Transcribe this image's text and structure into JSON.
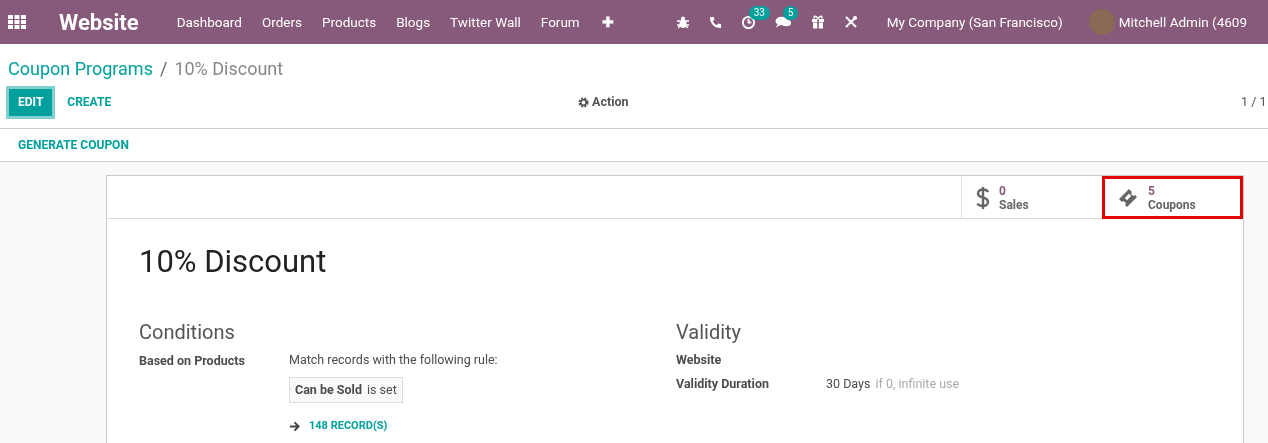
{
  "navbar": {
    "app_name": "Website",
    "menu": [
      "Dashboard",
      "Orders",
      "Products",
      "Blogs",
      "Twitter Wall",
      "Forum",
      "✚"
    ],
    "activity_badge": "33",
    "message_badge": "5",
    "company": "My Company (San Francisco)",
    "user": "Mitchell Admin (4609"
  },
  "breadcrumb": {
    "parent": "Coupon Programs",
    "separator": "/",
    "current": "10% Discount"
  },
  "control_panel": {
    "buttons": [
      {
        "label": "EDIT",
        "kind": "primary"
      },
      {
        "label": "CREATE",
        "kind": "link"
      }
    ],
    "action": "Action",
    "pager": "1 / 1"
  },
  "header_buttons": [
    "GENERATE COUPON"
  ],
  "stat_buttons": [
    {
      "value": "0",
      "label": "Sales",
      "highlighted": false
    },
    {
      "value": "5",
      "label": "Coupons",
      "highlighted": true
    }
  ],
  "record": {
    "title": "10% Discount",
    "conditions": {
      "heading": "Conditions",
      "field_label": "Based on Products",
      "rule_intro": "Match records with the following rule:",
      "rule_field": "Can be Sold",
      "rule_operator": "is set",
      "records_link": "148 RECORD(S)"
    },
    "validity": {
      "heading": "Validity",
      "fields": [
        {
          "label": "Website"
        },
        {
          "label": "Validity Duration",
          "value": "30 Days",
          "hint": "if 0, infinite use"
        }
      ]
    }
  }
}
